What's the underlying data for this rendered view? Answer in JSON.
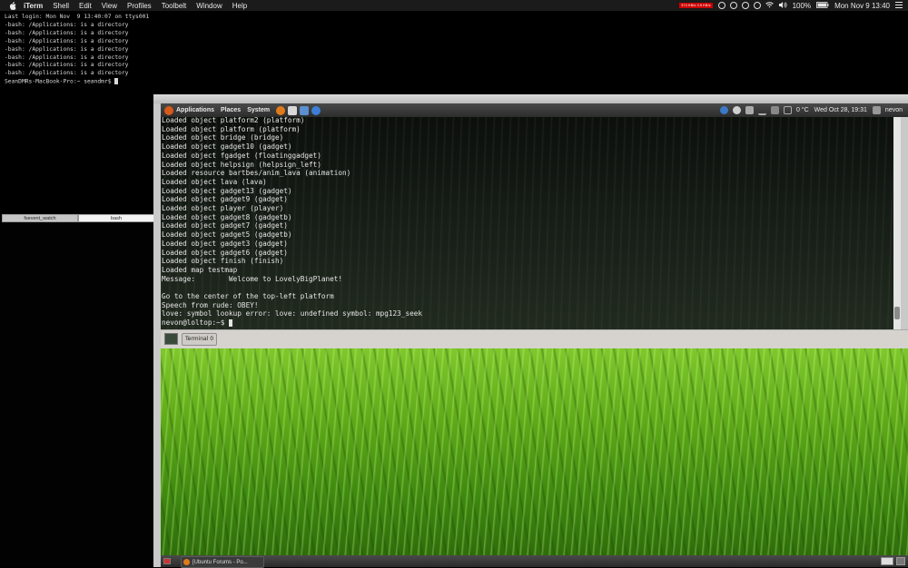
{
  "menubar": {
    "apple_icon": "apple-icon",
    "items": [
      "iTerm",
      "Shell",
      "Edit",
      "View",
      "Profiles",
      "Toolbelt",
      "Window",
      "Help"
    ],
    "right": {
      "net_gauge": "374 KB/s 3.5 KB/s",
      "battery": "100%",
      "datetime": "Mon Nov 9  13:40"
    }
  },
  "iterm": {
    "lines": [
      "Last login: Mon Nov  9 13:40:07 on ttys001",
      "-bash: /Applications: is a directory",
      "-bash: /Applications: is a directory",
      "-bash: /Applications: is a directory",
      "-bash: /Applications: is a directory",
      "-bash: /Applications: is a directory",
      "-bash: /Applications: is a directory",
      "-bash: /Applications: is a directory"
    ],
    "prompt": "SeanDMRs-MacBook-Pro:~ seandmr$ ",
    "tabs": [
      "fsevent_watch",
      "bash"
    ]
  },
  "gnome_panel": {
    "menus": [
      "Applications",
      "Places",
      "System"
    ],
    "temperature": "0 °C",
    "datetime": "Wed Oct 28, 19:31",
    "user": "nevon"
  },
  "guest_terminal": {
    "lines": [
      "Loaded object platform2 (platform)",
      "Loaded object platform (platform)",
      "Loaded object bridge (bridge)",
      "Loaded object gadget10 (gadget)",
      "Loaded object fgadget (floatinggadget)",
      "Loaded object helpsign (helpsign_left)",
      "Loaded resource bartbes/anim_lava (animation)",
      "Loaded object lava (lava)",
      "Loaded object gadget13 (gadget)",
      "Loaded object gadget9 (gadget)",
      "Loaded object player (player)",
      "Loaded object gadget8 (gadgetb)",
      "Loaded object gadget7 (gadget)",
      "Loaded object gadget5 (gadgetb)",
      "Loaded object gadget3 (gadget)",
      "Loaded object gadget6 (gadget)",
      "Loaded object finish (finish)",
      "Loaded map testmap",
      "Message:        Welcome to LovelyBigPlanet!",
      "",
      "Go to the center of the top-left platform",
      "Speech from rude: OBEY!",
      "love: symbol lookup error: love: undefined symbol: mpg123_seek"
    ],
    "prompt": "nevon@loltop:~$ "
  },
  "guest_tabbar": {
    "tab_label": "Terminal 0"
  },
  "guest_taskbar": {
    "task_label": "[Ubuntu Forums - Po..."
  }
}
